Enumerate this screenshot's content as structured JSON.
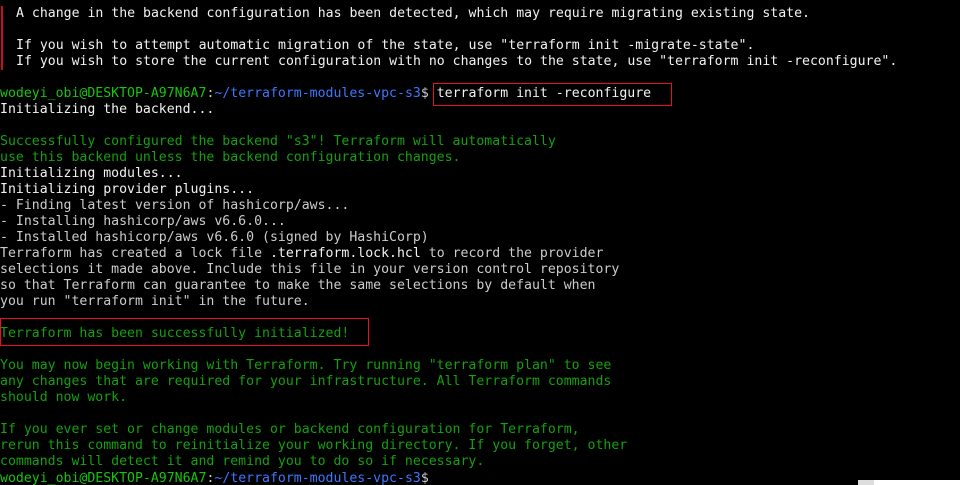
{
  "terminal": {
    "colors": {
      "background": "#000000",
      "default_text": "#cccccc",
      "bright_text": "#f2f2f2",
      "success_green": "#13a10e",
      "prompt_user_green": "#16c60c",
      "prompt_path_blue": "#3b78ff",
      "error_red": "#c50f1f",
      "highlight_box": "#e81123"
    },
    "warning": {
      "line1": "A change in the backend configuration has been detected, which may require migrating existing state.",
      "line2": "If you wish to attempt automatic migration of the state, use \"terraform init -migrate-state\".",
      "line3": "If you wish to store the current configuration with no changes to the state, use \"terraform init -reconfigure\"."
    },
    "prompt1": {
      "user_host": "wodeyi_obi@DESKTOP-A97N6A7",
      "separator": ":",
      "path": "~/terraform-modules-vpc-s3",
      "symbol": "$",
      "command": " terraform init -reconfigure"
    },
    "output": {
      "init_backend": "Initializing the backend...",
      "backend_ok_1": "Successfully configured the backend \"s3\"! Terraform will automatically",
      "backend_ok_2": "use this backend unless the backend configuration changes.",
      "init_modules": "Initializing modules...",
      "init_plugins": "Initializing provider plugins...",
      "finding": "- Finding latest version of hashicorp/aws...",
      "installing": "- Installing hashicorp/aws v6.6.0...",
      "installed": "- Installed hashicorp/aws v6.6.0 (signed by HashiCorp)",
      "lock_1_a": "Terraform has created a lock file ",
      "lock_1_file": ".terraform.lock.hcl",
      "lock_1_b": " to record the provider",
      "lock_2": "selections it made above. Include this file in your version control repository",
      "lock_3": "so that Terraform can guarantee to make the same selections by default when",
      "lock_4": "you run \"terraform init\" in the future.",
      "success": "Terraform has been successfully initialized!",
      "next_1": "You may now begin working with Terraform. Try running \"terraform plan\" to see",
      "next_2": "any changes that are required for your infrastructure. All Terraform commands",
      "next_3": "should now work.",
      "reinit_1": "If you ever set or change modules or backend configuration for Terraform,",
      "reinit_2": "rerun this command to reinitialize your working directory. If you forget, other",
      "reinit_3": "commands will detect it and remind you to do so if necessary."
    },
    "prompt2": {
      "user_host": "wodeyi_obi@DESKTOP-A97N6A7",
      "separator": ":",
      "path": "~/terraform-modules-vpc-s3",
      "symbol": "$"
    }
  }
}
